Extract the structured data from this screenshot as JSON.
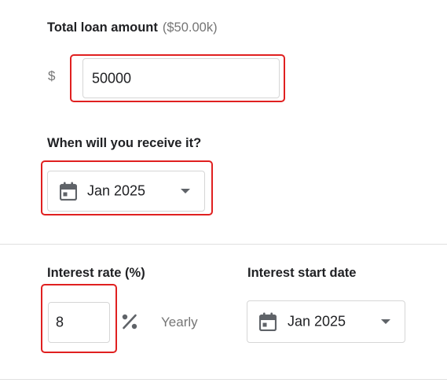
{
  "loan_amount": {
    "label": "Total loan amount",
    "formatted": "($50.00k)",
    "currency_symbol": "$",
    "value": "50000"
  },
  "receive_date": {
    "label": "When will you receive it?",
    "value": "Jan 2025",
    "icon": "calendar-icon"
  },
  "interest_rate": {
    "label": "Interest rate (%)",
    "value": "8",
    "unit_icon": "percent-icon",
    "frequency": "Yearly"
  },
  "interest_start_date": {
    "label": "Interest start date",
    "value": "Jan 2025",
    "icon": "calendar-icon"
  },
  "colors": {
    "highlight": "#e02020",
    "border": "#d6d6d6",
    "muted_text": "#757575"
  }
}
